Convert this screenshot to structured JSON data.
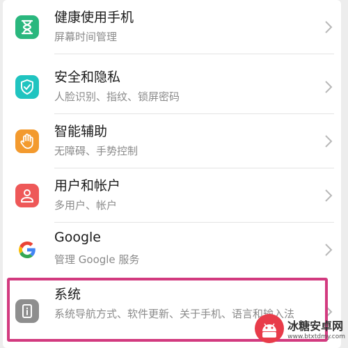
{
  "settings": {
    "items": [
      {
        "title": "健康使用手机",
        "subtitle": "屏幕时间管理",
        "icon": "hourglass-icon",
        "color": "#2ab77e"
      },
      {
        "title": "安全和隐私",
        "subtitle": "人脸识别、指纹、锁屏密码",
        "icon": "shield-check-icon",
        "color": "#20c4c0"
      },
      {
        "title": "智能辅助",
        "subtitle": "无障碍、手势控制",
        "icon": "hand-icon",
        "color": "#f39a2e"
      },
      {
        "title": "用户和帐户",
        "subtitle": "多用户、帐户",
        "icon": "user-icon",
        "color": "#ee5858"
      },
      {
        "title": "Google",
        "subtitle": "管理 Google 服务",
        "icon": "google-g-icon",
        "color": "#ffffff"
      },
      {
        "title": "系统",
        "subtitle": "系统导航方式、软件更新、关于手机、语言和输入法",
        "icon": "info-icon",
        "color": "#8e8e8e"
      }
    ]
  },
  "highlight": {
    "color": "#d23a7f"
  },
  "watermark": {
    "title": "冰糖安卓网",
    "url": "www.btxtdmy.com"
  }
}
